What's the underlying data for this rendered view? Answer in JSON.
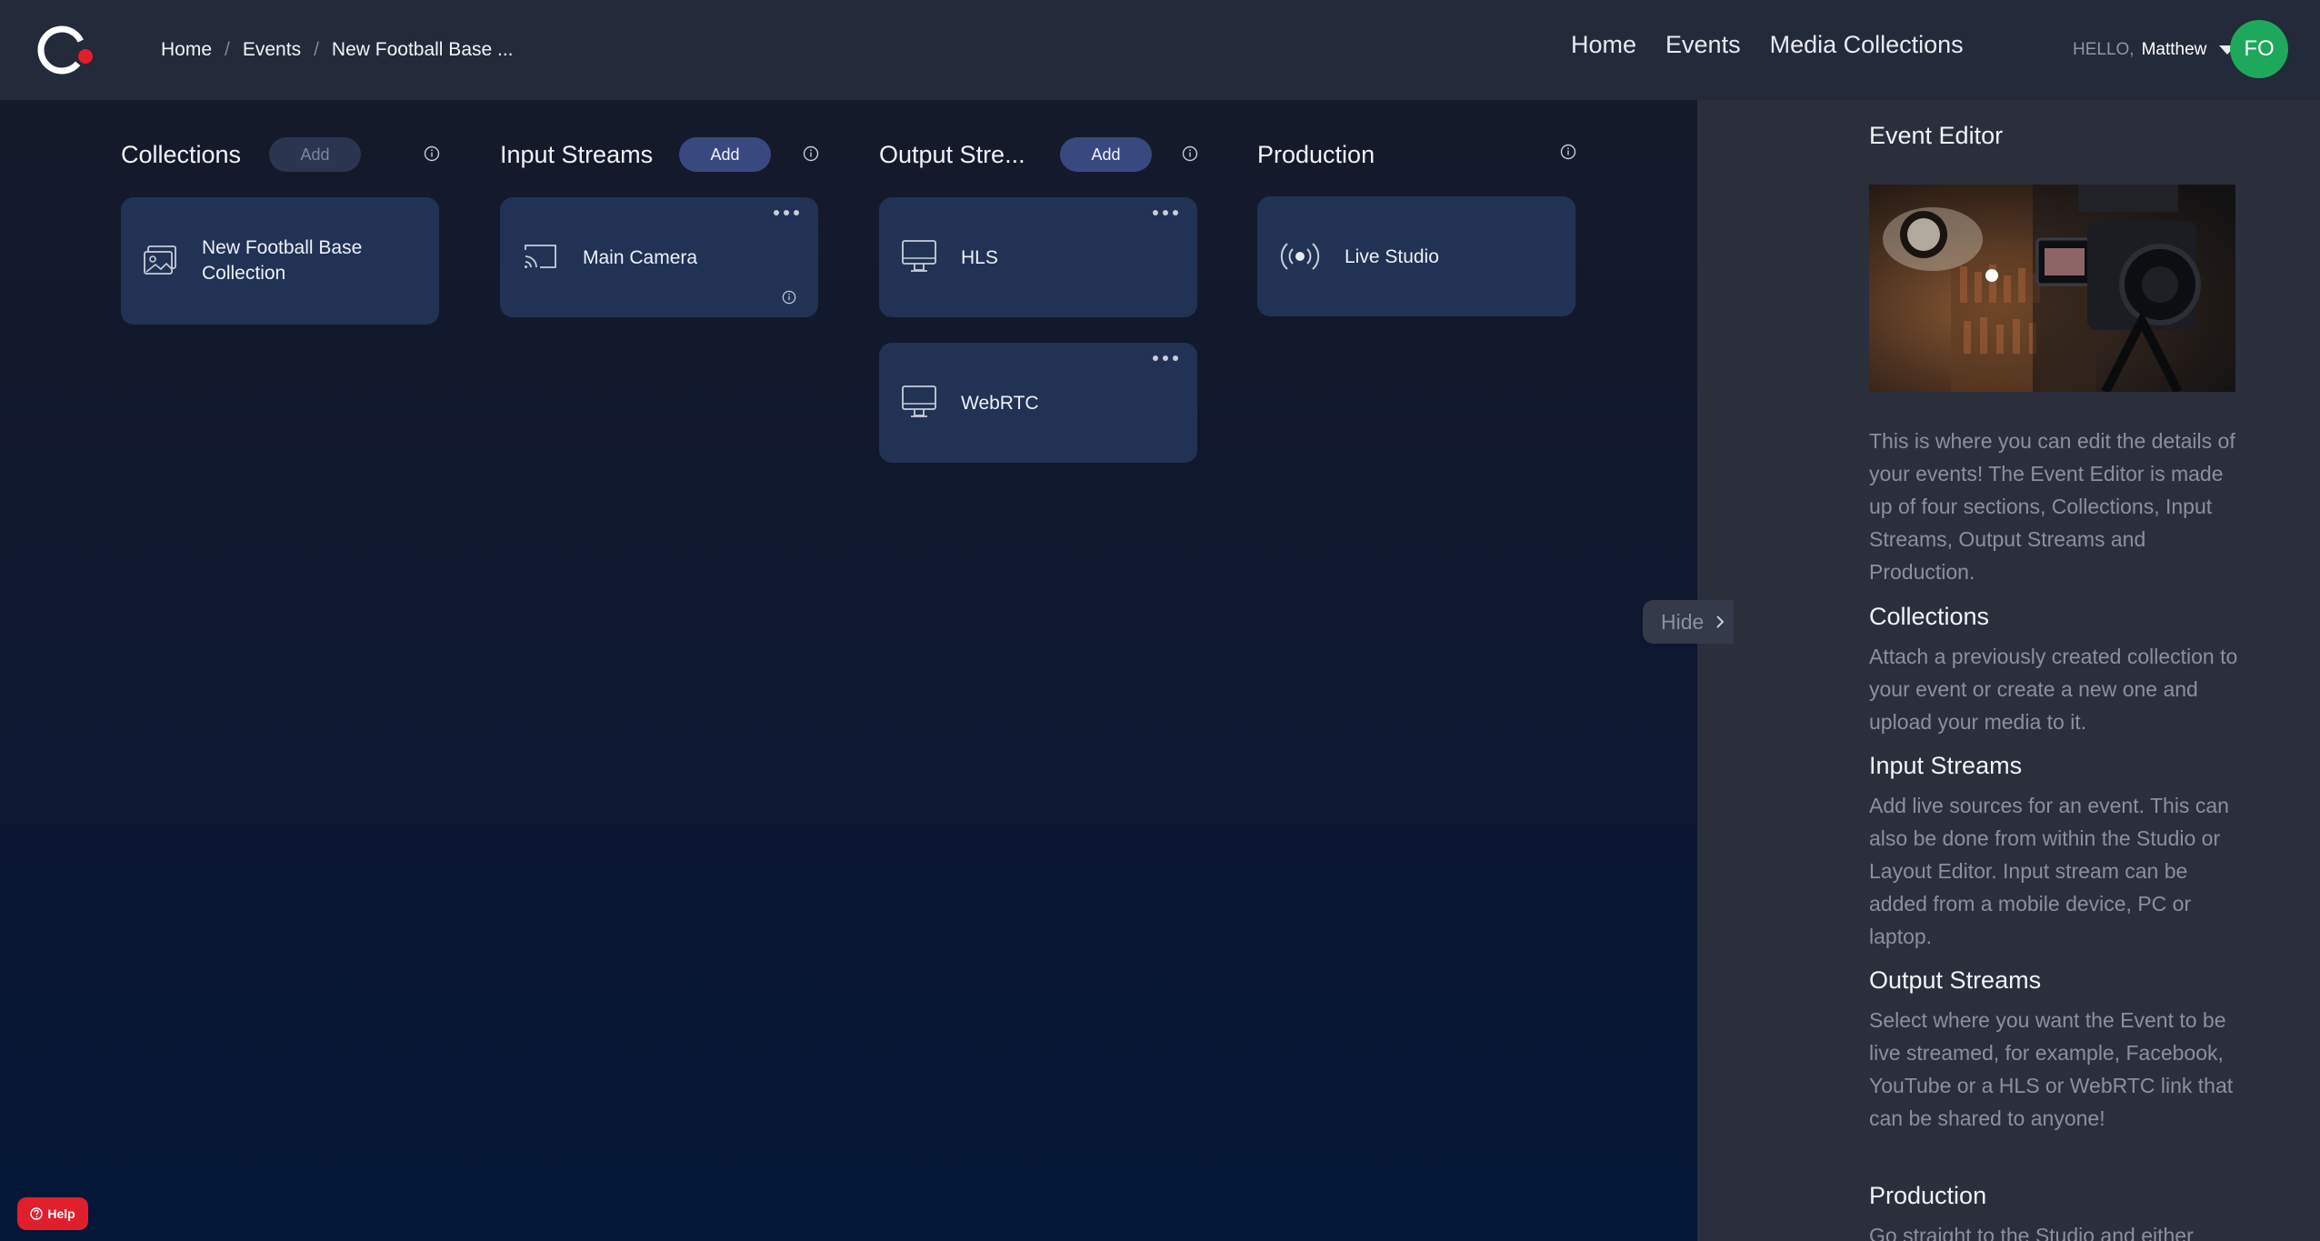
{
  "header": {
    "breadcrumb": [
      "Home",
      "Events",
      "New Football Base ..."
    ],
    "nav": [
      "Home",
      "Events",
      "Media Collections"
    ],
    "user": {
      "hello": "HELLO,",
      "name": "Matthew",
      "initials": "FO"
    }
  },
  "columns": {
    "collections": {
      "title": "Collections",
      "add_label": "Add",
      "cards": [
        {
          "label": "New Football Base Collection",
          "icon": "image-icon"
        }
      ]
    },
    "input_streams": {
      "title": "Input Streams",
      "add_label": "Add",
      "cards": [
        {
          "label": "Main Camera",
          "icon": "cast-icon"
        }
      ]
    },
    "output_streams": {
      "title": "Output Stre...",
      "add_label": "Add",
      "cards": [
        {
          "label": "HLS",
          "icon": "monitor-icon"
        },
        {
          "label": "WebRTC",
          "icon": "monitor-icon"
        }
      ]
    },
    "production": {
      "title": "Production",
      "cards": [
        {
          "label": "Live Studio",
          "icon": "broadcast-icon"
        }
      ]
    }
  },
  "panel": {
    "title": "Event Editor",
    "intro": "This is where you can edit the details of your events! The Event Editor is made up of four sections, Collections, Input Streams, Output Streams and Production.",
    "sections": [
      {
        "heading": "Collections",
        "text": "Attach a previously created collection to your event or create a new one and upload your media to it."
      },
      {
        "heading": "Input Streams",
        "text": "Add live sources for an event. This can also be done from within the Studio or Layout Editor. Input stream can be added from a mobile device, PC or laptop."
      },
      {
        "heading": "Output Streams",
        "text": "Select where you want the Event to be live streamed, for example, Facebook, YouTube or a HLS or WebRTC link that can be shared to anyone!"
      },
      {
        "heading": "Production",
        "text": "Go straight to the Studio and either"
      }
    ],
    "hide_label": "Hide"
  },
  "help_label": "Help",
  "colors": {
    "brand_red": "#e01f2c",
    "avatar_green": "#1ea85b",
    "card_bg": "#213255",
    "panel_bg": "#2b2f3c"
  }
}
